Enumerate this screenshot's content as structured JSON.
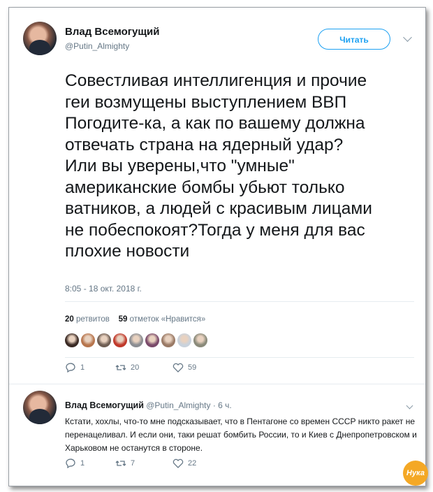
{
  "tweet": {
    "author_name": "Влад Всемогущий",
    "author_handle": "@Putin_Almighty",
    "follow_label": "Читать",
    "text": "Совестливая интеллигенция и прочие\nгеи возмущены выступлением ВВП\nПогодите-ка, а как по вашему должна\nотвечать страна на ядерный удар?\nИли вы уверены,что \"умные\"\nамериканские бомбы убьют только\nватников, а людей с красивым лицами\nне побеспокоят?Тогда у меня для вас\nплохие новости",
    "timestamp": "8:05 - 18 окт. 2018 г.",
    "retweets_count": "20",
    "retweets_label": "ретвитов",
    "likes_count": "59",
    "likes_label": "отметок «Нравится»",
    "likers": [
      "#3a2a24",
      "#b7754d",
      "#6f5e53",
      "#c0392b",
      "#8b8d92",
      "#7a4a6a",
      "#9a7a66",
      "#c9d2dc",
      "#8a8a7a"
    ],
    "actions": {
      "replies": "1",
      "retweets": "20",
      "likes": "59"
    }
  },
  "reply": {
    "author_name": "Влад Всемогущий",
    "author_handle": "@Putin_Almighty",
    "age": "· 6 ч.",
    "text": "Кстати, хохлы, что-то мне подсказывает, что в Пентагоне со времен СССР никто ракет не перенацеливал. И если они, таки решат бомбить России, то и Киев с Днепропетровском и Харьковом не останутся в стороне.",
    "actions": {
      "replies": "1",
      "retweets": "7",
      "likes": "22"
    }
  },
  "watermark": "Нука",
  "colors": {
    "accent": "#1da1f2",
    "muted": "#657786",
    "text": "#14171a"
  }
}
